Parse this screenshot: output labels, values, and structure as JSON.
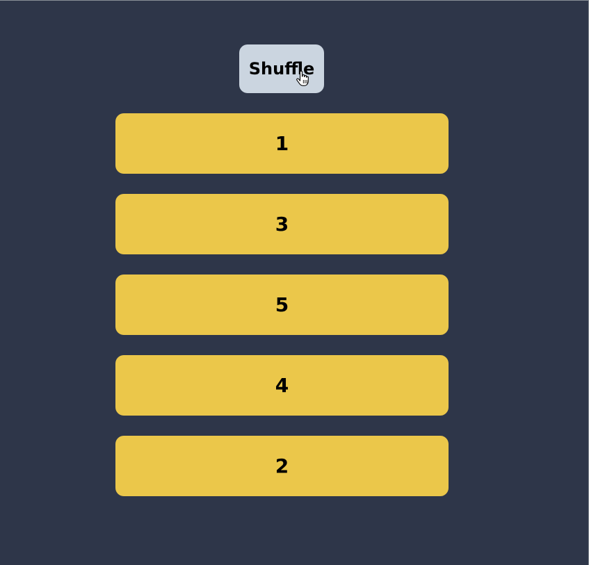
{
  "toolbar": {
    "shuffle_label": "Shuffle",
    "cursor_icon": "hand-pointer-icon"
  },
  "list": {
    "items": [
      {
        "label": "1"
      },
      {
        "label": "3"
      },
      {
        "label": "5"
      },
      {
        "label": "4"
      },
      {
        "label": "2"
      }
    ]
  },
  "colors": {
    "background": "#2e3649",
    "button": "#cbd5e0",
    "card": "#ebc74a",
    "text": "#000000"
  }
}
